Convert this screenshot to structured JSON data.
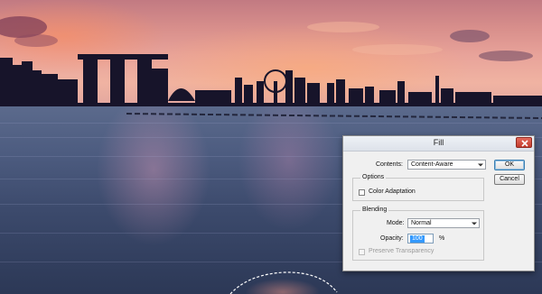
{
  "dialog": {
    "title": "Fill",
    "contents_label": "Contents:",
    "contents_value": "Content-Aware",
    "ok_label": "OK",
    "cancel_label": "Cancel",
    "options": {
      "title": "Options",
      "color_adaptation_label": "Color Adaptation",
      "color_adaptation_checked": false
    },
    "blending": {
      "title": "Blending",
      "mode_label": "Mode:",
      "mode_value": "Normal",
      "opacity_label": "Opacity:",
      "opacity_value": "100",
      "opacity_unit": "%",
      "preserve_transparency_label": "Preserve Transparency",
      "preserve_transparency_checked": false
    }
  },
  "colors": {
    "close_button": "#c94a3c",
    "input_selection": "#3399ff",
    "dialog_bg": "#f0f0f0"
  },
  "icons": {
    "close": "close-icon",
    "dropdown": "chevron-down-icon"
  }
}
